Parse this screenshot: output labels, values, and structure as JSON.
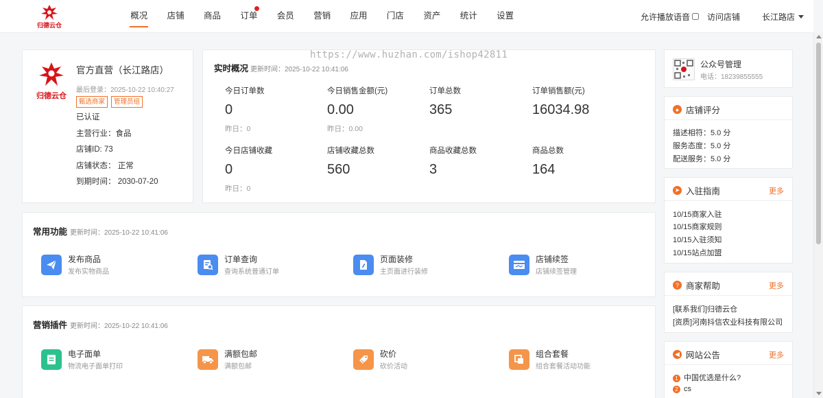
{
  "brand": {
    "name": "归德云仓",
    "accent": "#f07028",
    "logo_red": "#d7141a"
  },
  "nav": [
    {
      "label": "概况",
      "active": true
    },
    {
      "label": "店铺"
    },
    {
      "label": "商品"
    },
    {
      "label": "订单",
      "dot": true
    },
    {
      "label": "会员"
    },
    {
      "label": "营销"
    },
    {
      "label": "应用"
    },
    {
      "label": "门店"
    },
    {
      "label": "资产"
    },
    {
      "label": "统计"
    },
    {
      "label": "设置"
    }
  ],
  "header_right": {
    "voice_label": "允许播放语音",
    "voice_checked": false,
    "visit_label": "访问店铺",
    "store_label": "长江路店"
  },
  "watermark": "https://www.huzhan.com/ishop42811",
  "store": {
    "name": "官方直营（长江路店）",
    "last_login": "最后登录：2025-10-22 10:40:27",
    "tags": [
      "甄选商家",
      "管理员组"
    ],
    "certified": "已认证",
    "industry": "主营行业：食品",
    "store_id": "店铺ID: 73",
    "status": "店铺状态：  正常",
    "expire": "到期时间：  2030-07-20"
  },
  "realtime": {
    "title": "实时概况",
    "updated": "更新时间：2025-10-22 10:41:06",
    "stats": [
      {
        "label": "今日订单数",
        "value": "0",
        "yesterday": "昨日：0"
      },
      {
        "label": "今日销售金额(元)",
        "value": "0.00",
        "yesterday": "昨日：0.00"
      },
      {
        "label": "订单总数",
        "value": "365",
        "yesterday": ""
      },
      {
        "label": "订单销售额(元)",
        "value": "16034.98",
        "yesterday": ""
      },
      {
        "label": "今日店铺收藏",
        "value": "0",
        "yesterday": "昨日：0"
      },
      {
        "label": "店铺收藏总数",
        "value": "560",
        "yesterday": ""
      },
      {
        "label": "商品收藏总数",
        "value": "3",
        "yesterday": ""
      },
      {
        "label": "商品总数",
        "value": "164",
        "yesterday": ""
      }
    ]
  },
  "common_functions": {
    "title": "常用功能",
    "updated": "更新时间：2025-10-22 10:41:06",
    "items": [
      {
        "title": "发布商品",
        "desc": "发布实物商品",
        "icon": "paper-plane-icon",
        "color": "#4a8cf0"
      },
      {
        "title": "订单查询",
        "desc": "查询系统普通订单",
        "icon": "order-search-icon",
        "color": "#4a8cf0"
      },
      {
        "title": "页面装修",
        "desc": "主页面进行装修",
        "icon": "page-edit-icon",
        "color": "#4a8cf0"
      },
      {
        "title": "店铺续签",
        "desc": "店铺续签管理",
        "icon": "renew-icon",
        "color": "#4a8cf0"
      }
    ]
  },
  "marketing_plugins": {
    "title": "营销插件",
    "updated": "更新时间：2025-10-22 10:41:06",
    "items": [
      {
        "title": "电子面单",
        "desc": "物流电子面单打印",
        "icon": "waybill-icon",
        "color": "#2bc28e"
      },
      {
        "title": "满额包邮",
        "desc": "满额包邮",
        "icon": "truck-icon",
        "color": "#f5954a"
      },
      {
        "title": "砍价",
        "desc": "砍价活动",
        "icon": "bargain-icon",
        "color": "#f5954a"
      },
      {
        "title": "组合套餐",
        "desc": "组合套餐活动功能",
        "icon": "combo-icon",
        "color": "#f5954a"
      }
    ]
  },
  "wechat": {
    "title": "公众号管理",
    "phone": "电话：18239855555"
  },
  "rating": {
    "title": "店铺评分",
    "items": [
      "描述相符：5.0 分",
      "服务态度：5.0 分",
      "配送服务：5.0 分"
    ]
  },
  "guide": {
    "title": "入驻指南",
    "more": "更多",
    "items": [
      "10/15商家入驻",
      "10/15商家规则",
      "10/15入驻须知",
      "10/15站点加盟"
    ]
  },
  "help": {
    "title": "商家帮助",
    "more": "更多",
    "items": [
      "[联系我们]归德云仓",
      "[资质]河南抖信农业科技有限公司"
    ]
  },
  "notice": {
    "title": "网站公告",
    "more": "更多",
    "items": [
      {
        "num": "1",
        "text": "中国优选是什么?"
      },
      {
        "num": "2",
        "text": "cs"
      }
    ]
  }
}
